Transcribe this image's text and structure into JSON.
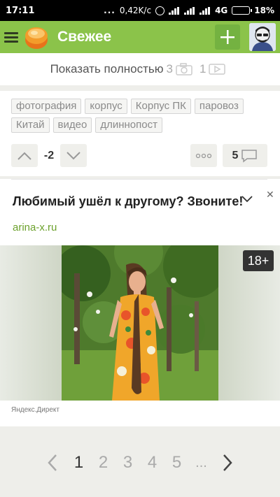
{
  "statusbar": {
    "time": "17:11",
    "dots": "...",
    "speed": "0,42K/c",
    "network": "4G",
    "battery": "18%"
  },
  "appbar": {
    "title": "Свежее",
    "menu_icon": "hamburger-icon",
    "add_icon": "plus-icon"
  },
  "post": {
    "show_full_label": "Показать полностью",
    "photo_count": "3",
    "video_count": "1",
    "tags": [
      "фотография",
      "корпус",
      "Корпус ПК",
      "паровоз",
      "Китай",
      "видео",
      "длиннопост"
    ],
    "rating": "-2",
    "comments_count": "5"
  },
  "ad": {
    "title": "Любимый ушёл к другому? Звоните!",
    "url": "arina-x.ru",
    "age_badge": "18+",
    "source": "Яндекс.Директ"
  },
  "pagination": {
    "pages": [
      "1",
      "2",
      "3",
      "4",
      "5",
      "..."
    ],
    "current": "1"
  },
  "colors": {
    "accent": "#8bc34a",
    "accent_dark": "#74b241",
    "link": "#6ca12c"
  }
}
